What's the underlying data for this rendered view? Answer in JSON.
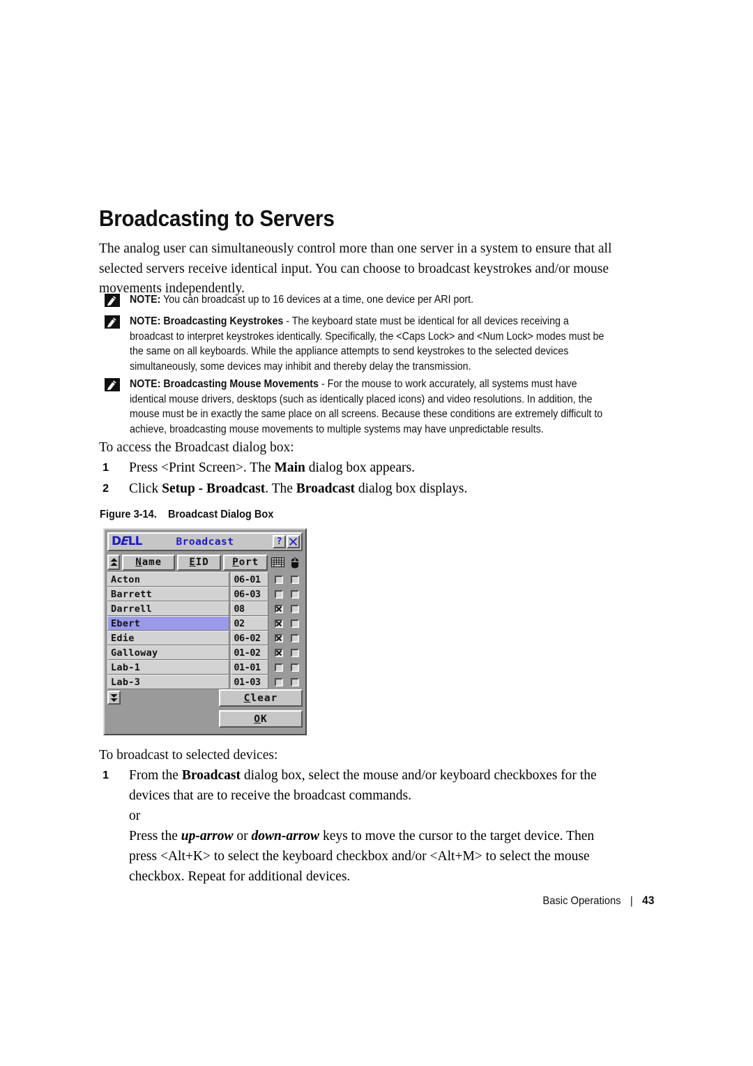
{
  "page": {
    "heading": "Broadcasting to Servers",
    "intro": "The analog user can simultaneously control more than one server in a system to ensure that all selected servers receive identical input. You can choose to broadcast keystrokes and/or mouse movements independently."
  },
  "notes": [
    {
      "icon": "note-pencil-icon",
      "label": "NOTE:",
      "text": " You can broadcast up to 16 devices at a time, one device per ARI port."
    },
    {
      "icon": "note-pencil-icon",
      "label": "NOTE:",
      "bold_title": " Broadcasting Keystrokes",
      "text": " - The keyboard state must be identical for all devices receiving a broadcast to interpret keystrokes identically. Specifically, the <Caps Lock> and <Num Lock> modes must be the same on all keyboards. While the appliance attempts to send keystrokes to the selected devices simultaneously, some devices may inhibit and thereby delay the transmission."
    },
    {
      "icon": "note-pencil-icon",
      "label": "NOTE:",
      "bold_title": "  Broadcasting Mouse Movements",
      "text": " - For the mouse to work accurately, all systems must have identical mouse drivers, desktops (such as identically placed icons) and video resolutions. In addition, the mouse must be in exactly the same place on all screens. Because these conditions are extremely difficult to achieve, broadcasting mouse movements to multiple systems may have unpredictable results."
    }
  ],
  "access": {
    "lead": "To access the Broadcast dialog box:",
    "steps": [
      {
        "num": "1",
        "prefix": "Press <Print Screen>. The ",
        "bold": "Main",
        "suffix": " dialog box appears."
      },
      {
        "num": "2",
        "prefix": "Click ",
        "bold": "Setup - Broadcast",
        "mid": ". The ",
        "bold2": "Broadcast",
        "suffix": " dialog box displays."
      }
    ]
  },
  "figure": {
    "caption": "Figure 3-14.    Broadcast Dialog Box"
  },
  "dialog": {
    "brand": "DELL",
    "title": "Broadcast",
    "help_button": "?",
    "close_button": "X",
    "scroll_up_icon": "scroll-up-icon",
    "scroll_down_icon": "scroll-down-icon",
    "columns": [
      {
        "key": "name",
        "label": "Name",
        "accel": "N"
      },
      {
        "key": "eid",
        "label": "EID",
        "accel": "E"
      },
      {
        "key": "port",
        "label": "Port",
        "accel": "P"
      }
    ],
    "keyboard_icon": "keyboard-icon",
    "mouse_icon": "mouse-icon",
    "rows": [
      {
        "name": "Acton",
        "port": "06-01",
        "keyboard": false,
        "mouse": false,
        "selected": false
      },
      {
        "name": "Barrett",
        "port": "06-03",
        "keyboard": false,
        "mouse": false,
        "selected": false
      },
      {
        "name": "Darrell",
        "port": "08",
        "keyboard": true,
        "mouse": false,
        "selected": false
      },
      {
        "name": "Ebert",
        "port": "02",
        "keyboard": true,
        "mouse": false,
        "selected": true
      },
      {
        "name": "Edie",
        "port": "06-02",
        "keyboard": true,
        "mouse": false,
        "selected": false
      },
      {
        "name": "Galloway",
        "port": "01-02",
        "keyboard": true,
        "mouse": false,
        "selected": false
      },
      {
        "name": "Lab-1",
        "port": "01-01",
        "keyboard": false,
        "mouse": false,
        "selected": false
      },
      {
        "name": "Lab-3",
        "port": "01-03",
        "keyboard": false,
        "mouse": false,
        "selected": false
      }
    ],
    "buttons": [
      {
        "key": "clear",
        "label": "Clear",
        "accel": "C"
      },
      {
        "key": "ok",
        "label": "OK",
        "accel": "O"
      }
    ],
    "colors": {
      "face": "#c6c6c6",
      "dialog_bg": "#9a9a9a",
      "row_bg": "#d2d2d2",
      "selection": "#9a9aea",
      "brand_blue": "#1b1bc8"
    }
  },
  "broadcast": {
    "lead": "To broadcast to selected devices:",
    "step_num": "1",
    "line1_prefix": "From the ",
    "line1_bold": "Broadcast",
    "line1_suffix": " dialog box, select the mouse and/or keyboard checkboxes for the devices that are to receive the broadcast commands.",
    "or": "or",
    "line2_a": "Press the ",
    "line2_i1": "up-arrow",
    "line2_b": " or ",
    "line2_i2": "down-arrow",
    "line2_c": " keys to move the cursor to the target device. Then press <Alt+K> to select the keyboard checkbox and/or <Alt+M> to select the mouse checkbox. Repeat for additional devices."
  },
  "footer": {
    "section": "Basic Operations",
    "separator": "|",
    "page_number": "43"
  }
}
